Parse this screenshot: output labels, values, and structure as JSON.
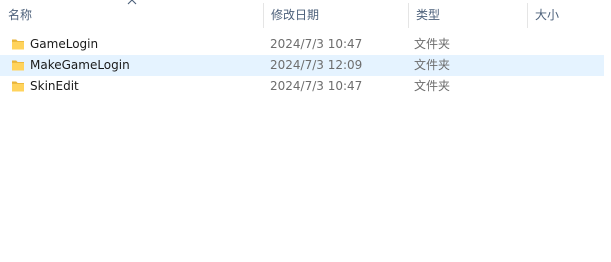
{
  "columns": {
    "name": "名称",
    "date": "修改日期",
    "type": "类型",
    "size": "大小"
  },
  "sort": {
    "column": "name",
    "direction": "ascending",
    "icon": "sort-up-icon"
  },
  "files": [
    {
      "name": "GameLogin",
      "date": "2024/7/3 10:47",
      "type": "文件夹",
      "icon": "folder-icon"
    },
    {
      "name": "MakeGameLogin",
      "date": "2024/7/3 12:09",
      "type": "文件夹",
      "icon": "folder-icon",
      "hovered": true
    },
    {
      "name": "SkinEdit",
      "date": "2024/7/3 10:47",
      "type": "文件夹",
      "icon": "folder-icon"
    }
  ],
  "colors": {
    "hover_background": "#e5f3ff",
    "header_text": "#4c607a",
    "folder_yellow": "#ffd35c"
  }
}
